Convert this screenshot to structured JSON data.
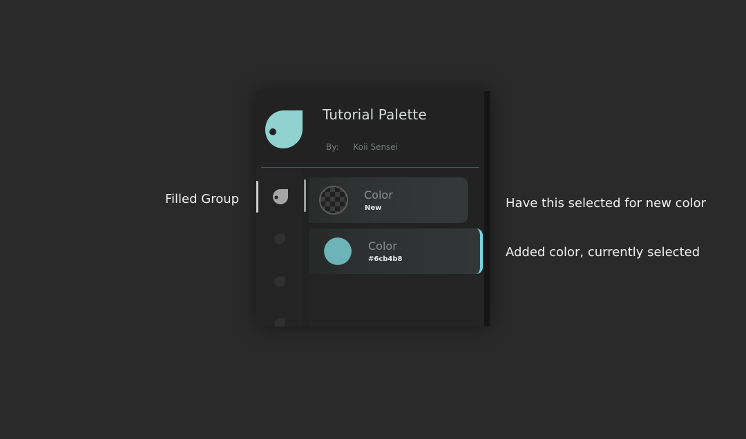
{
  "annotations": {
    "filled_group": "Filled Group",
    "new_color": "Have this selected for new color",
    "added_color": "Added color, currently selected"
  },
  "palette": {
    "title": "Tutorial Palette",
    "author_prefix": "By:",
    "author_name": "Koii Sensei",
    "icon": "palette-drop-icon"
  },
  "groups": [
    {
      "icon": "filled-group-icon",
      "state": "selected"
    },
    {
      "icon": "group-icon",
      "state": "unselected"
    },
    {
      "icon": "group-icon",
      "state": "unselected"
    },
    {
      "icon": "group-icon",
      "state": "unselected"
    }
  ],
  "colors": [
    {
      "name": "Color",
      "value_label": "New",
      "swatch": "checkerboard"
    },
    {
      "name": "Color",
      "value_label": "#6cb4b8",
      "swatch": "#6cb4b8",
      "selected": true
    }
  ],
  "theme": {
    "background": "#2a2a2a",
    "panel": "#222222",
    "accent": "#78d1df",
    "palette_icon": "#8fd2d0"
  }
}
